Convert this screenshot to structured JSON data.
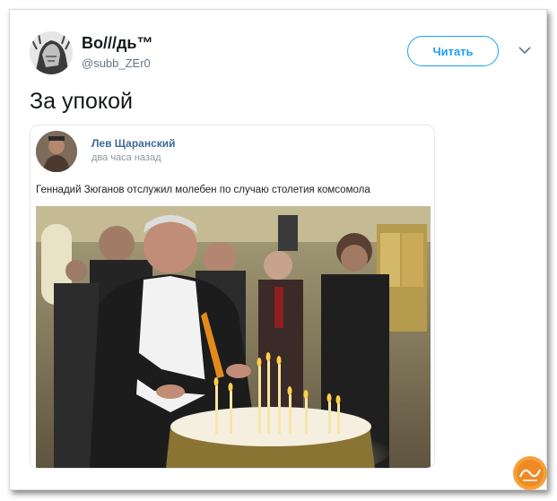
{
  "tweet": {
    "author_name": "Во///дь™",
    "author_handle": "@subb_ZEr0",
    "follow_label": "Читать",
    "text": "За упокой"
  },
  "card": {
    "author_name": "Лев Щаранский",
    "time": "два часа назад",
    "text": "Геннадий Зюганов отслужил молебен по случаю столетия комсомола"
  },
  "icons": {
    "menu": "chevron-down-icon",
    "watermark": "nyka-logo"
  },
  "colors": {
    "accent": "#1da1f2",
    "card_author": "#3e6a98",
    "watermark": "#f08a24"
  }
}
